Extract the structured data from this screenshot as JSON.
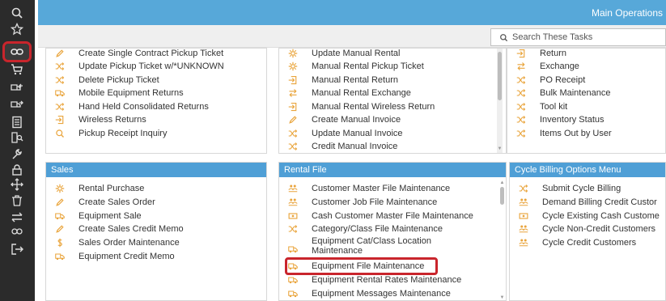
{
  "header": {
    "title": "Main Operations"
  },
  "search": {
    "placeholder": "Search These Tasks"
  },
  "colors": {
    "accent": "#57a8d9",
    "panel_header": "#4f9fd6",
    "icon": "#e9a43b",
    "highlight": "#c9252c",
    "sidebar": "#2b2b2b"
  },
  "sidebar": {
    "items": [
      {
        "icon": "search-icon"
      },
      {
        "icon": "star-icon"
      },
      {
        "icon": "chain-link-icon",
        "selected": true
      },
      {
        "icon": "cart-icon"
      },
      {
        "icon": "truck-return-icon"
      },
      {
        "icon": "truck-forward-icon"
      },
      {
        "icon": "calculator-icon"
      },
      {
        "icon": "doc-search-icon"
      },
      {
        "icon": "wrench-icon"
      },
      {
        "icon": "lock-icon"
      },
      {
        "icon": "move-icon"
      },
      {
        "icon": "trash-icon"
      },
      {
        "icon": "swap-icon"
      },
      {
        "icon": "rings-icon"
      },
      {
        "icon": "logout-icon"
      }
    ]
  },
  "pickup_panel": {
    "items": [
      {
        "label": "Create Single Contract Pickup Ticket",
        "icon": "pencil-icon"
      },
      {
        "label": "Update Pickup Ticket w/*UNKNOWN",
        "icon": "shuffle-icon"
      },
      {
        "label": "Delete Pickup Ticket",
        "icon": "shuffle-icon"
      },
      {
        "label": "Mobile Equipment Returns",
        "icon": "truck-icon"
      },
      {
        "label": "Hand Held Consolidated Returns",
        "icon": "shuffle-icon"
      },
      {
        "label": "Wireless Returns",
        "icon": "import-icon"
      },
      {
        "label": "Pickup Receipt Inquiry",
        "icon": "search-icon"
      }
    ]
  },
  "rental_panel": {
    "items": [
      {
        "label": "Update Manual Rental",
        "icon": "gear-icon"
      },
      {
        "label": "Manual Rental Pickup Ticket",
        "icon": "gear-icon"
      },
      {
        "label": "Manual Rental Return",
        "icon": "import-icon"
      },
      {
        "label": "Manual Rental Exchange",
        "icon": "exchange-icon"
      },
      {
        "label": "Manual Rental Wireless Return",
        "icon": "import-icon"
      },
      {
        "label": "Create Manual Invoice",
        "icon": "pencil-icon"
      },
      {
        "label": "Update Manual Invoice",
        "icon": "shuffle-icon"
      },
      {
        "label": "Credit Manual Invoice",
        "icon": "shuffle-icon"
      }
    ]
  },
  "return_panel": {
    "items": [
      {
        "label": "Return",
        "icon": "import-icon"
      },
      {
        "label": "Exchange",
        "icon": "exchange-icon"
      },
      {
        "label": "PO Receipt",
        "icon": "shuffle-icon"
      },
      {
        "label": "Bulk Maintenance",
        "icon": "shuffle-icon"
      },
      {
        "label": "Tool kit",
        "icon": "shuffle-icon"
      },
      {
        "label": "Inventory Status",
        "icon": "shuffle-icon"
      },
      {
        "label": "Items Out by User",
        "icon": "shuffle-icon"
      }
    ]
  },
  "sales_panel": {
    "title": "Sales",
    "items": [
      {
        "label": "Rental Purchase",
        "icon": "gear-icon"
      },
      {
        "label": "Create Sales Order",
        "icon": "pencil-icon"
      },
      {
        "label": "Equipment Sale",
        "icon": "truck-icon"
      },
      {
        "label": "Create Sales Credit Memo",
        "icon": "pencil-icon"
      },
      {
        "label": "Sales Order Maintenance",
        "icon": "dollar-icon"
      },
      {
        "label": "Equipment Credit Memo",
        "icon": "truck-icon"
      }
    ]
  },
  "rental_file_panel": {
    "title": "Rental File",
    "items": [
      {
        "label": "Customer Master File Maintenance",
        "icon": "users-icon"
      },
      {
        "label": "Customer Job File Maintenance",
        "icon": "users-icon"
      },
      {
        "label": "Cash Customer Master File Maintenance",
        "icon": "cash-icon"
      },
      {
        "label": "Category/Class File Maintenance",
        "icon": "shuffle-icon"
      },
      {
        "label": "Equipment Cat/Class Location Maintenance",
        "icon": "truck-icon"
      },
      {
        "label": "Equipment File Maintenance",
        "icon": "truck-icon",
        "highlighted": true
      },
      {
        "label": "Equipment Rental Rates Maintenance",
        "icon": "truck-icon"
      },
      {
        "label": "Equipment Messages Maintenance",
        "icon": "truck-icon"
      }
    ]
  },
  "cycle_panel": {
    "title": "Cycle Billing Options Menu",
    "items": [
      {
        "label": "Submit Cycle Billing",
        "icon": "shuffle-icon"
      },
      {
        "label": "Demand Billing Credit Custor",
        "icon": "users-icon"
      },
      {
        "label": "Cycle Existing Cash Custome",
        "icon": "cash-icon"
      },
      {
        "label": "Cycle Non-Credit Customers",
        "icon": "users-icon"
      },
      {
        "label": "Cycle Credit Customers",
        "icon": "users-icon"
      }
    ]
  }
}
